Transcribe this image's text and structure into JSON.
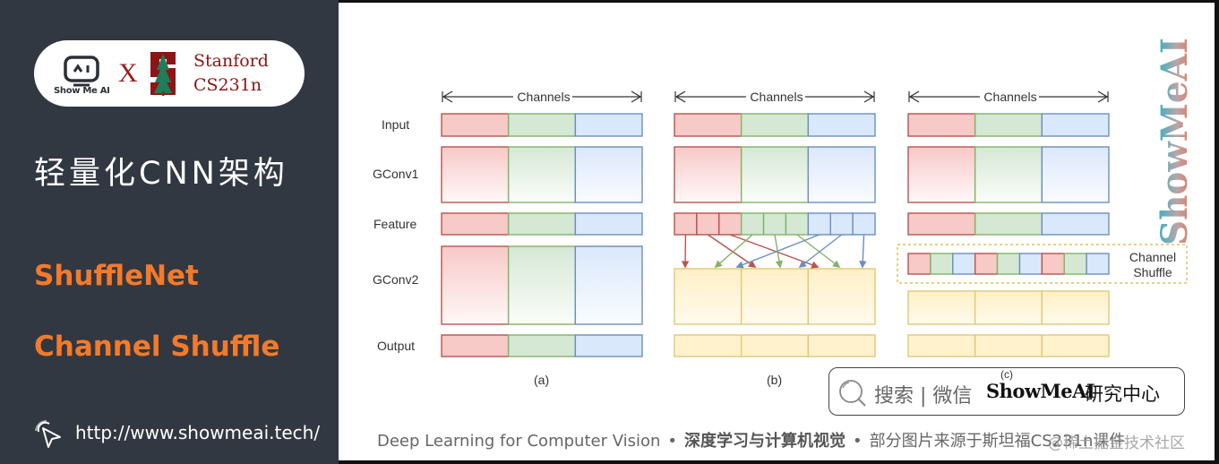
{
  "sidebar": {
    "logo": {
      "brand_caption": "Show Me AI",
      "cross": "X",
      "partner_line1": "Stanford",
      "partner_line2": "CS231n"
    },
    "title": "轻量化CNN架构",
    "topics": [
      "ShuffleNet",
      "Channel Shuffle"
    ],
    "url": "http://www.showmeai.tech/"
  },
  "diagram": {
    "axis_label": "Channels",
    "row_labels": [
      "Input",
      "GConv1",
      "Feature",
      "GConv2",
      "Output"
    ],
    "panels": [
      {
        "caption": "(a)",
        "description": "group convolutions stacked without cross-group communication"
      },
      {
        "caption": "(b)",
        "description": "feature groups subdivided and fed across groups"
      },
      {
        "caption": "(c)",
        "description": "equivalent implementation using channel shuffle"
      }
    ],
    "channel_shuffle_label_line1": "Channel",
    "channel_shuffle_label_line2": "Shuffle",
    "group_colors": {
      "red_fill": "#f7c9c7",
      "red_stroke": "#b85450",
      "green_fill": "#d5e8d4",
      "green_stroke": "#82b366",
      "blue_fill": "#dae8fc",
      "blue_stroke": "#6c8ebf",
      "yellow_fill": "#fff2cc",
      "yellow_stroke": "#e0c878"
    },
    "shuffle_order": [
      "red",
      "green",
      "blue",
      "red",
      "green",
      "blue",
      "red",
      "green",
      "blue"
    ]
  },
  "watermark": "ShowMeAI",
  "search": {
    "label": "搜索 | 微信",
    "brand": "ShowMeAI",
    "suffix": "研究中心"
  },
  "footer": {
    "course": "Deep Learning for Computer Vision",
    "separator": "•",
    "course_cn": "深度学习与计算机视觉",
    "credit": "部分图片来源于斯坦福CS231n课件",
    "platform_watermark": "@稀土掘金技术社区"
  },
  "colors": {
    "sidebar_bg": "#323842",
    "accent_orange": "#f47a2a",
    "stanford_red": "#8c1515"
  }
}
